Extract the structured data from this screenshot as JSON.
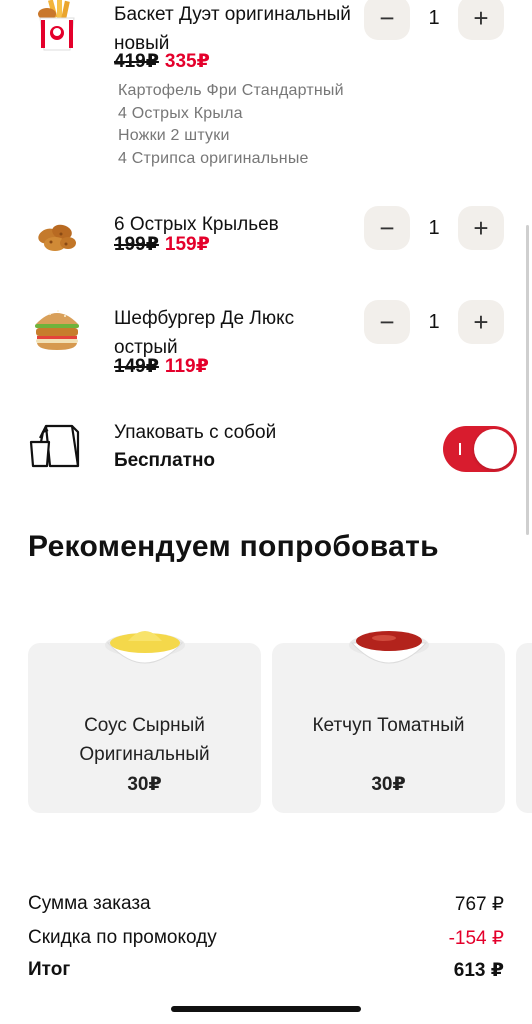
{
  "cart": {
    "items": [
      {
        "name": "Баскет Дуэт оригинальный новый",
        "old_price": "419₽",
        "new_price": "335₽",
        "quantity": "1",
        "combo": [
          "Картофель Фри Стандартный",
          "4 Острых Крыла",
          "Ножки 2 штуки",
          "4 Стрипса оригинальные"
        ]
      },
      {
        "name": "6 Острых Крыльев",
        "old_price": "199₽",
        "new_price": "159₽",
        "quantity": "1"
      },
      {
        "name": "Шефбургер Де Люкс острый",
        "old_price": "149₽",
        "new_price": "119₽",
        "quantity": "1"
      }
    ],
    "stepper": {
      "minus": "−",
      "plus": "+"
    }
  },
  "takeaway": {
    "label": "Упаковать с собой",
    "price": "Бесплатно",
    "enabled": true
  },
  "recommend": {
    "title": "Рекомендуем попробовать",
    "items": [
      {
        "name": "Соус Сырный Оригинальный",
        "price": "30₽"
      },
      {
        "name": "Кетчуп Томатный",
        "price": "30₽"
      }
    ]
  },
  "summary": {
    "subtotal_label": "Сумма заказа",
    "subtotal_value": "767 ₽",
    "discount_label": "Скидка по промокоду",
    "discount_value": "-154 ₽",
    "total_label": "Итог",
    "total_value": "613 ₽"
  },
  "colors": {
    "accent": "#e4002b",
    "toggle": "#d81c2e",
    "stepper_bg": "#f2efeb",
    "card_bg": "#f2f2f2"
  }
}
